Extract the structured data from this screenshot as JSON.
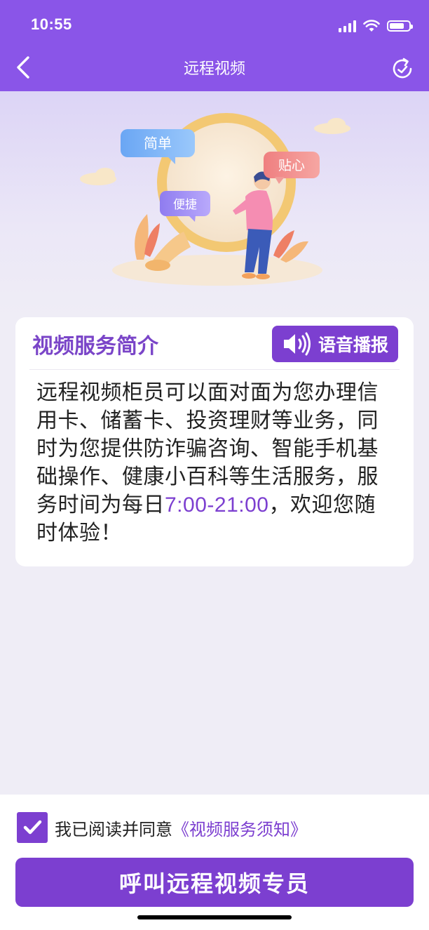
{
  "status_bar": {
    "time": "10:55"
  },
  "nav": {
    "title": "远程视频"
  },
  "hero": {
    "bubbles": {
      "simple": "简单",
      "convenient": "便捷",
      "caring": "贴心"
    }
  },
  "intro_card": {
    "title": "视频服务简介",
    "voice_button_label": "语音播报",
    "body_before": "远程视频柜员可以面对面为您办理信用卡、储蓄卡、投资理财等业务，同时为您提供防诈骗咨询、智能手机基础操作、健康小百科等生活服务，服务时间为每日",
    "body_highlight": "7:00-21:00",
    "body_after": "，欢迎您随时体验！"
  },
  "agreement": {
    "checked": true,
    "text": "我已阅读并同意",
    "link_text": "《视频服务须知》"
  },
  "call_button_label": "呼叫远程视频专员",
  "colors": {
    "header_purple": "#8a55e8",
    "accent_purple": "#7c3fd0",
    "page_bg": "#efedf6"
  },
  "icons": [
    "back-icon",
    "refresh-icon",
    "speaker-icon",
    "checkmark-icon"
  ]
}
